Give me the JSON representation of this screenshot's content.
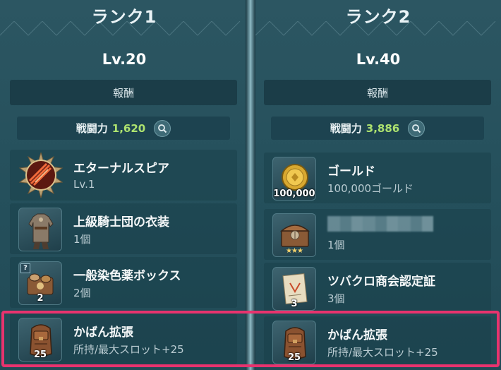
{
  "ranks": [
    {
      "title": "ランク1",
      "level": "Lv.20",
      "reward_label": "報酬",
      "power_label": "戦闘力",
      "power_value": "1,620",
      "items": [
        {
          "name": "エターナルスピア",
          "desc": "Lv.1",
          "qty": "",
          "icon": "spear-emblem-icon"
        },
        {
          "name": "上級騎士団の衣装",
          "desc": "1個",
          "qty": "",
          "icon": "armor-costume-icon"
        },
        {
          "name": "一般染色薬ボックス",
          "desc": "2個",
          "qty": "2",
          "icon": "dye-box-icon",
          "badge": "?"
        },
        {
          "name": "かばん拡張",
          "desc": "所持/最大スロット+25",
          "qty": "25",
          "icon": "backpack-icon"
        }
      ]
    },
    {
      "title": "ランク2",
      "level": "Lv.40",
      "reward_label": "報酬",
      "power_label": "戦闘力",
      "power_value": "3,886",
      "items": [
        {
          "name": "ゴールド",
          "desc": "100,000ゴールド",
          "qty": "100,000",
          "icon": "gold-coin-icon"
        },
        {
          "name": "",
          "desc": "1個",
          "qty": "",
          "icon": "treasure-chest-icon",
          "stars": "★★★"
        },
        {
          "name": "ツバクロ商会認定証",
          "desc": "3個",
          "qty": "3",
          "icon": "certificate-icon"
        },
        {
          "name": "かばん拡張",
          "desc": "所持/最大スロット+25",
          "qty": "25",
          "icon": "backpack-icon"
        }
      ]
    }
  ],
  "colors": {
    "panel": "#25505c",
    "power_value": "#ade26f",
    "highlight": "#e8336e"
  }
}
